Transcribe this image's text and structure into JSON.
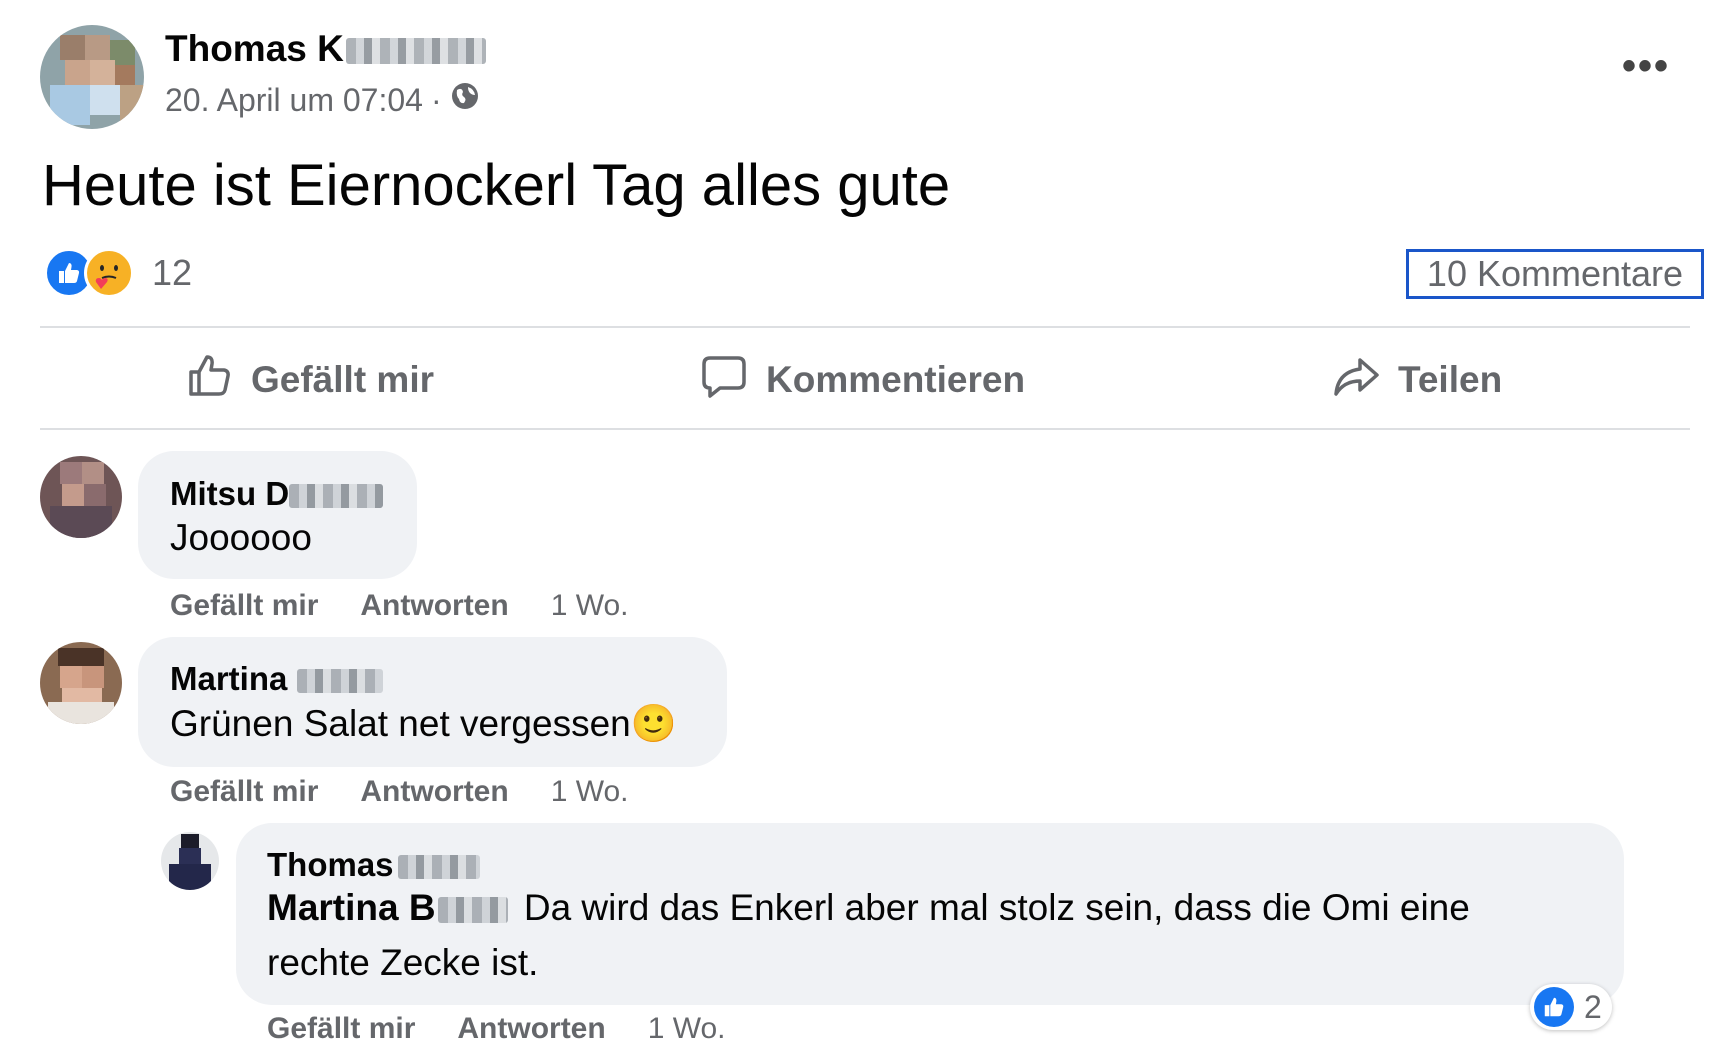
{
  "post": {
    "author_name": "Thomas K",
    "timestamp": "20. April um 07:04",
    "separator": "·",
    "audience_icon": "globe-icon",
    "more_icon": "more-icon",
    "text": "Heute ist Eiernockerl Tag alles gute",
    "reaction_icons": [
      "like-icon",
      "care-icon"
    ],
    "reaction_count": "12",
    "comments_count_label": "10 Kommentare"
  },
  "actions": {
    "like_label": "Gefällt mir",
    "comment_label": "Kommentieren",
    "share_label": "Teilen"
  },
  "comments": [
    {
      "author": "Mitsu D",
      "text": "Joooooo",
      "like_label": "Gefällt mir",
      "reply_label": "Antworten",
      "time": "1 Wo."
    },
    {
      "author": "Martina",
      "text": "Grünen Salat net vergessen",
      "emoji": "🙂",
      "like_label": "Gefällt mir",
      "reply_label": "Antworten",
      "time": "1 Wo."
    }
  ],
  "reply": {
    "author": "Thomas",
    "mention": "Martina B",
    "text_line1": "Da wird das Enkerl aber mal stolz sein, dass die Omi eine",
    "text_line2": "rechte Zecke ist.",
    "like_label": "Gefällt mir",
    "reply_label": "Antworten",
    "time": "1 Wo.",
    "reaction_count": "2"
  },
  "colors": {
    "accent": "#1877f2",
    "secondary_text": "#65676b",
    "bubble": "#f0f2f5",
    "focus_outline": "#1a56c9"
  }
}
